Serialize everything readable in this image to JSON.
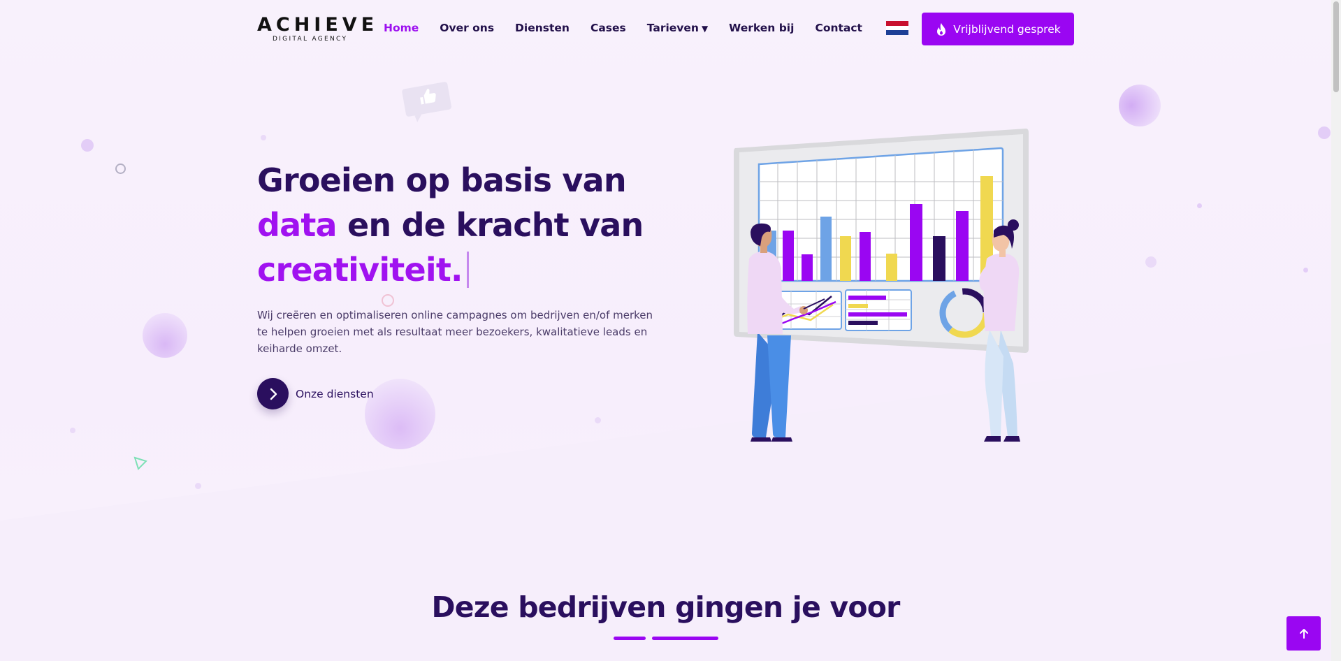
{
  "logo": {
    "main": "ACHIEVE",
    "sub": "DIGITAL AGENCY"
  },
  "nav": {
    "items": [
      {
        "label": "Home",
        "active": true
      },
      {
        "label": "Over ons"
      },
      {
        "label": "Diensten"
      },
      {
        "label": "Cases"
      },
      {
        "label": "Tarieven",
        "caret": "▼"
      },
      {
        "label": "Werken bij"
      },
      {
        "label": "Contact"
      }
    ],
    "language_flag": "flag-nl-icon"
  },
  "cta": {
    "label": "Vrijblijvend gesprek",
    "icon": "flame-icon"
  },
  "hero": {
    "title_part1": "Groeien op basis van ",
    "title_accent1": "data",
    "title_part2": " en de kracht van ",
    "title_accent2": "creativiteit.",
    "text": "Wij creëren en optimaliseren online campagnes om bedrijven en/of merken te helpen groeien met als resultaat meer bezoekers, kwalitatieve leads en keiharde omzet.",
    "link_label": "Onze diensten",
    "link_icon": "chevron-right-icon"
  },
  "section": {
    "title": "Deze bedrijven gingen je voor"
  },
  "back_to_top": {
    "icon": "arrow-up-icon"
  },
  "colors": {
    "accent": "#9a06f2",
    "dark": "#2a0f5e",
    "yellow": "#f0d850",
    "blue": "#6ea3e6",
    "flag_red": "#c8102e",
    "flag_white": "#ffffff",
    "flag_blue": "#1d3f96"
  }
}
